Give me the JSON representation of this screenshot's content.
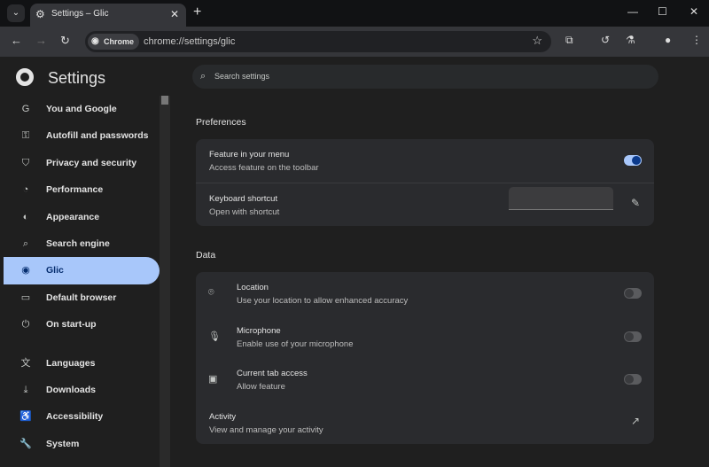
{
  "browser": {
    "tab_title": "Settings – Glic",
    "chip_label": "Chrome",
    "url": "chrome://settings/glic"
  },
  "header": {
    "title": "Settings",
    "search_placeholder": "Search settings"
  },
  "sidebar": {
    "items": [
      {
        "label": "You and Google",
        "icon": "G"
      },
      {
        "label": "Autofill and passwords",
        "icon": "⚿"
      },
      {
        "label": "Privacy and security",
        "icon": "⛉"
      },
      {
        "label": "Performance",
        "icon": "◔"
      },
      {
        "label": "Appearance",
        "icon": "◐"
      },
      {
        "label": "Search engine",
        "icon": "⌕"
      },
      {
        "label": "Glic",
        "icon": "◉",
        "active": true
      },
      {
        "label": "Default browser",
        "icon": "▭"
      },
      {
        "label": "On start-up",
        "icon": "⏻"
      },
      {
        "label": "Languages",
        "icon": "文"
      },
      {
        "label": "Downloads",
        "icon": "⤓"
      },
      {
        "label": "Accessibility",
        "icon": "♿"
      },
      {
        "label": "System",
        "icon": "🔧"
      }
    ]
  },
  "preferences": {
    "heading": "Preferences",
    "feature": {
      "title": "Feature in your menu",
      "subtitle": "Access feature on the toolbar",
      "enabled": true
    },
    "shortcut": {
      "title": "Keyboard shortcut",
      "subtitle": "Open with shortcut",
      "value": ""
    }
  },
  "data": {
    "heading": "Data",
    "location": {
      "title": "Location",
      "subtitle": "Use your location to allow enhanced accuracy",
      "enabled": false
    },
    "microphone": {
      "title": "Microphone",
      "subtitle": "Enable use of your microphone",
      "enabled": false
    },
    "tab_access": {
      "title": "Current tab access",
      "subtitle": "Allow feature",
      "enabled": false
    },
    "activity": {
      "title": "Activity",
      "subtitle": "View and manage your activity"
    }
  },
  "colors": {
    "accent": "#a8c7fa",
    "background": "#1f1f1f",
    "card": "#2a2b2e"
  }
}
